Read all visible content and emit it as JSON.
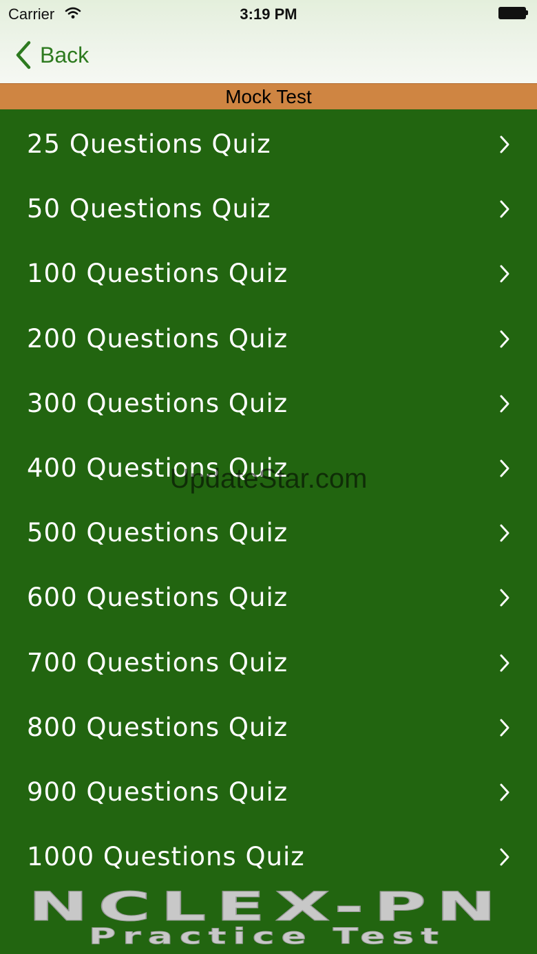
{
  "status_bar": {
    "carrier": "Carrier",
    "time": "3:19 PM"
  },
  "nav": {
    "back_label": "Back"
  },
  "page_title": "Mock Test",
  "quizzes": [
    {
      "label": "25 Questions Quiz"
    },
    {
      "label": "50 Questions Quiz"
    },
    {
      "label": "100 Questions Quiz"
    },
    {
      "label": "200 Questions Quiz"
    },
    {
      "label": "300 Questions Quiz"
    },
    {
      "label": "400 Questions Quiz"
    },
    {
      "label": "500 Questions Quiz"
    },
    {
      "label": "600 Questions Quiz"
    },
    {
      "label": "700 Questions Quiz"
    },
    {
      "label": "800 Questions Quiz"
    },
    {
      "label": "900 Questions Quiz"
    },
    {
      "label": "1000 Questions Quiz"
    }
  ],
  "watermark": "UpdateStar.com",
  "logo": {
    "line1": "NCLEX-PN",
    "line2": "Practice Test"
  },
  "colors": {
    "background": "#226510",
    "title_bar": "#cf8542",
    "back_tint": "#2d7a1f",
    "logo_text": "#c8c8c8"
  },
  "icons": {
    "wifi": "wifi-icon",
    "battery": "battery-icon",
    "back": "chevron-left-icon",
    "row": "chevron-right-icon"
  }
}
